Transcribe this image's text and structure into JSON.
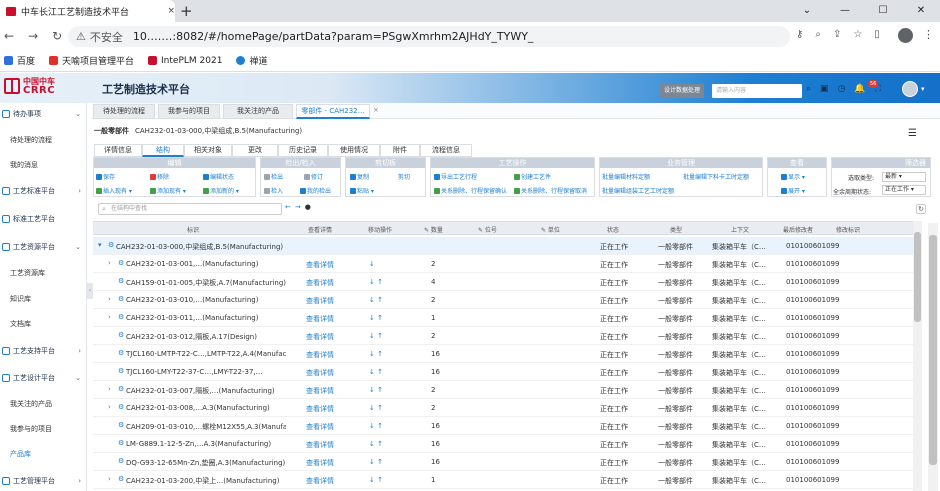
{
  "browser": {
    "tab_title": "中车长江工艺制造技术平台",
    "tab_close": "×",
    "new_tab": "+",
    "window_controls": [
      "⌄",
      "—",
      "☐",
      "✕"
    ],
    "nav": [
      "←",
      "→",
      "↻"
    ],
    "lock": "⚠",
    "not_secure": "不安全",
    "url": "10.……:8082/#/homePage/partData?param=PSgwXmrhm2AJHdY_TYWY_",
    "addr_icons": [
      "⚷",
      "⌕",
      "⇪",
      "☆",
      "▯"
    ],
    "menu": "⋮",
    "bookmarks": [
      {
        "label": "百度",
        "color": "#2f6fde"
      },
      {
        "label": "天喻项目管理平台",
        "color": "#e0302a"
      },
      {
        "label": "IntePLM 2021",
        "color": "#c8102e"
      },
      {
        "label": "禅道",
        "color": "#1d7fd2"
      }
    ]
  },
  "header": {
    "logo_cn": "中国中车",
    "logo_en": "CRRC",
    "title": "工艺制造技术平台",
    "design_btn": "设计数据处理",
    "search_placeholder": "请输入内容",
    "icons": [
      "⌕",
      "▣",
      "◷",
      "🔔",
      "⛶"
    ],
    "badge": "56",
    "avatar_caret": "▾"
  },
  "sidebar": {
    "collapse": "‹",
    "groups": [
      {
        "label": "待办事项",
        "caret": "⌄",
        "items": [
          "待处理的流程",
          "我的消息"
        ]
      },
      {
        "label": "工艺标准平台",
        "caret": "›",
        "items": [
          "标准工艺平台"
        ]
      },
      {
        "label": "工艺资源平台",
        "caret": "⌄",
        "items": [
          "工艺资源库",
          "知识库",
          "文档库"
        ]
      },
      {
        "label": "工艺支持平台",
        "caret": "›",
        "items": []
      },
      {
        "label": "工艺设计平台",
        "caret": "⌄",
        "items": [
          "我关注的产品",
          "我参与的项目",
          "产品库"
        ]
      },
      {
        "label": "工艺管理平台",
        "caret": "›",
        "items": []
      }
    ],
    "active_item": "产品库"
  },
  "page_tabs": {
    "items": [
      "待处理的流程",
      "我参与的项目",
      "我关注的产品",
      "零部件 - CAH232…"
    ],
    "close": "×"
  },
  "part": {
    "type_label": "一般零部件",
    "identity": "CAH232-01-03-000,中梁组成,B.5(Manufacturing)",
    "filter_icon": "☰",
    "sub_tabs": [
      "详情信息",
      "结构",
      "相关对象",
      "更改",
      "历史记录",
      "使用情况",
      "附件",
      "流程信息"
    ],
    "active_sub_tab": "结构"
  },
  "toolbar": {
    "groups": [
      {
        "title": "编辑",
        "buttons": [
          "保存",
          "移除",
          "编辑状态",
          "插入现有 ▾",
          "添加现有 ▾",
          "添加新的 ▾"
        ]
      },
      {
        "title": "检出/检入",
        "buttons": [
          "检出",
          "修订",
          "检入",
          "我的检出"
        ]
      },
      {
        "title": "剪切板",
        "buttons": [
          "复制",
          "剪切",
          "粘贴 ▾"
        ]
      },
      {
        "title": "工艺操作",
        "buttons": [
          "导出工艺行程",
          "创建工艺件",
          "关系删除、行程保留确认",
          "关系删除、行程保留取消"
        ]
      },
      {
        "title": "业务管理",
        "buttons": [
          "批量编辑材料定额",
          "批量编辑下料卡工时定额",
          "批量编辑组装工艺工时定额"
        ]
      },
      {
        "title": "查看",
        "buttons": [
          "显示 ▾",
          "展开 ▾"
        ]
      },
      {
        "title": "筛选器",
        "fields": [
          {
            "label": "选取类型:",
            "value": "最新 ▾"
          },
          {
            "label": "全余周期状态:",
            "value": "正在工作 ▾"
          }
        ]
      }
    ]
  },
  "tree_search": {
    "placeholder": "在结构中查找",
    "icon": "⌕",
    "controls": [
      "←",
      "→",
      "●"
    ],
    "refresh": "↻"
  },
  "table": {
    "columns": [
      "标识",
      "查看详情",
      "移动操作",
      "✎ 数量",
      "✎ 位号",
      "✎ 单位",
      "状态",
      "类型",
      "上下文",
      "最后修改者",
      "修改标识"
    ],
    "rows": [
      {
        "id": "CAH232-01-03-000,中梁组成,B.5(Manufacturing)",
        "detail": "",
        "move": "",
        "qty": "",
        "pos": "",
        "unit": "",
        "state": "正在工作",
        "type": "一般零部件",
        "ctx": "集装箱平车（C…",
        "modifier": "010100601099",
        "flag": "",
        "level": 0,
        "expander": "▾",
        "selected": true
      },
      {
        "id": "CAH232-01-03-001,…(Manufacturing)",
        "detail": "查看详情",
        "move": "↓",
        "qty": "2",
        "pos": "",
        "unit": "",
        "state": "正在工作",
        "type": "一般零部件",
        "ctx": "集装箱平车（C…",
        "modifier": "010100601099",
        "flag": "",
        "level": 1,
        "expander": "›"
      },
      {
        "id": "CAH159-01-01-005,中梁板,A.7(Manufacturing)",
        "detail": "查看详情",
        "move": "↓ ↑",
        "qty": "4",
        "pos": "",
        "unit": "",
        "state": "正在工作",
        "type": "一般零部件",
        "ctx": "集装箱平车（C…",
        "modifier": "010100601099",
        "flag": "",
        "level": 1,
        "expander": ""
      },
      {
        "id": "CAH232-01-03-010,…(Manufacturing)",
        "detail": "查看详情",
        "move": "↓ ↑",
        "qty": "2",
        "pos": "",
        "unit": "",
        "state": "正在工作",
        "type": "一般零部件",
        "ctx": "集装箱平车（C…",
        "modifier": "010100601099",
        "flag": "",
        "level": 1,
        "expander": "›"
      },
      {
        "id": "CAH232-01-03-011,…(Manufacturing)",
        "detail": "查看详情",
        "move": "↓ ↑",
        "qty": "1",
        "pos": "",
        "unit": "",
        "state": "正在工作",
        "type": "一般零部件",
        "ctx": "集装箱平车（C…",
        "modifier": "010100601099",
        "flag": "",
        "level": 1,
        "expander": "›"
      },
      {
        "id": "CAH232-01-03-012,隔板,A.17(Design)",
        "detail": "查看详情",
        "move": "↓ ↑",
        "qty": "2",
        "pos": "",
        "unit": "",
        "state": "正在工作",
        "type": "一般零部件",
        "ctx": "集装箱平车（C…",
        "modifier": "010100601099",
        "flag": "",
        "level": 1,
        "expander": ""
      },
      {
        "id": "TJCL160-LMTP-T22-C…,LMTP-T22,A.4(Manufacturing)",
        "detail": "查看详情",
        "move": "↓ ↑",
        "qty": "16",
        "pos": "",
        "unit": "",
        "state": "正在工作",
        "type": "一般零部件",
        "ctx": "集装箱平车（C…",
        "modifier": "010100601099",
        "flag": "",
        "level": 1,
        "expander": ""
      },
      {
        "id": "TJCL160-LMY-T22-37-C…,LMY-T22-37,…",
        "detail": "查看详情",
        "move": "↓ ↑",
        "qty": "16",
        "pos": "",
        "unit": "",
        "state": "正在工作",
        "type": "一般零部件",
        "ctx": "集装箱平车（C…",
        "modifier": "010100601099",
        "flag": "",
        "level": 1,
        "expander": ""
      },
      {
        "id": "CAH232-01-03-007,隔板,…(Manufacturing)",
        "detail": "查看详情",
        "move": "↓ ↑",
        "qty": "2",
        "pos": "",
        "unit": "",
        "state": "正在工作",
        "type": "一般零部件",
        "ctx": "集装箱平车（C…",
        "modifier": "010100601099",
        "flag": "",
        "level": 1,
        "expander": "›"
      },
      {
        "id": "CAH232-01-03-008,…A.3(Manufacturing)",
        "detail": "查看详情",
        "move": "↓ ↑",
        "qty": "2",
        "pos": "",
        "unit": "",
        "state": "正在工作",
        "type": "一般零部件",
        "ctx": "集装箱平车（C…",
        "modifier": "010100601099",
        "flag": "",
        "level": 1,
        "expander": "›"
      },
      {
        "id": "CAH209-01-03-010,…螺栓M12X55,A.3(Manufacturing)",
        "detail": "查看详情",
        "move": "↓ ↑",
        "qty": "16",
        "pos": "",
        "unit": "",
        "state": "正在工作",
        "type": "一般零部件",
        "ctx": "集装箱平车（C…",
        "modifier": "010100601099",
        "flag": "",
        "level": 1,
        "expander": ""
      },
      {
        "id": "LM-G889.1-12-5-Zn,…A.3(Manufacturing)",
        "detail": "查看详情",
        "move": "↓ ↑",
        "qty": "16",
        "pos": "",
        "unit": "",
        "state": "正在工作",
        "type": "一般零部件",
        "ctx": "集装箱平车（C…",
        "modifier": "010100601099",
        "flag": "",
        "level": 1,
        "expander": ""
      },
      {
        "id": "DQ-G93-12-65Mn-Zn,垫圈,A.3(Manufacturing)",
        "detail": "查看详情",
        "move": "↓ ↑",
        "qty": "16",
        "pos": "",
        "unit": "",
        "state": "正在工作",
        "type": "一般零部件",
        "ctx": "集装箱平车（C…",
        "modifier": "010100601099",
        "flag": "",
        "level": 1,
        "expander": ""
      },
      {
        "id": "CAH232-01-03-200,中梁上…(Manufacturing)",
        "detail": "查看详情",
        "move": "↓ ↑",
        "qty": "1",
        "pos": "",
        "unit": "",
        "state": "正在工作",
        "type": "一般零部件",
        "ctx": "集装箱平车（C…",
        "modifier": "010100601099",
        "flag": "",
        "level": 1,
        "expander": "›"
      }
    ]
  }
}
